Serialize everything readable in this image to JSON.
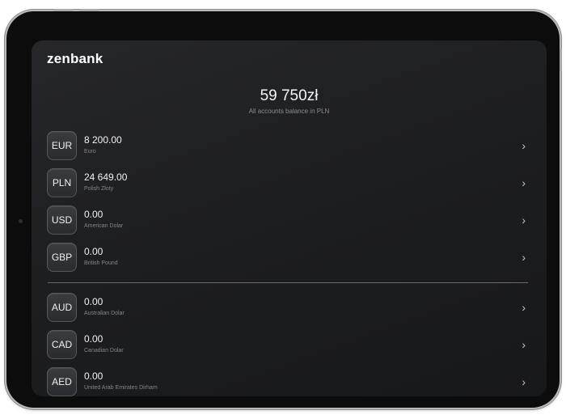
{
  "app": {
    "logo": "zenbank"
  },
  "summary": {
    "total": "59 750zł",
    "caption": "All accounts balance in PLN"
  },
  "accounts_primary": [
    {
      "code": "EUR",
      "amount": "8 200.00",
      "name": "Euro"
    },
    {
      "code": "PLN",
      "amount": "24 649.00",
      "name": "Polish Złoty"
    },
    {
      "code": "USD",
      "amount": "0.00",
      "name": "American Dolar"
    },
    {
      "code": "GBP",
      "amount": "0.00",
      "name": "British Pound"
    }
  ],
  "accounts_secondary": [
    {
      "code": "AUD",
      "amount": "0.00",
      "name": "Australian Dolar"
    },
    {
      "code": "CAD",
      "amount": "0.00",
      "name": "Canadian Dolar"
    },
    {
      "code": "AED",
      "amount": "0.00",
      "name": "United Arab Emirates Dirham"
    }
  ],
  "icons": {
    "row_arrow": "chevron-right-icon"
  },
  "colors": {
    "background": "#1d1e20",
    "text": "#f2f2f2",
    "muted": "#85868a"
  }
}
